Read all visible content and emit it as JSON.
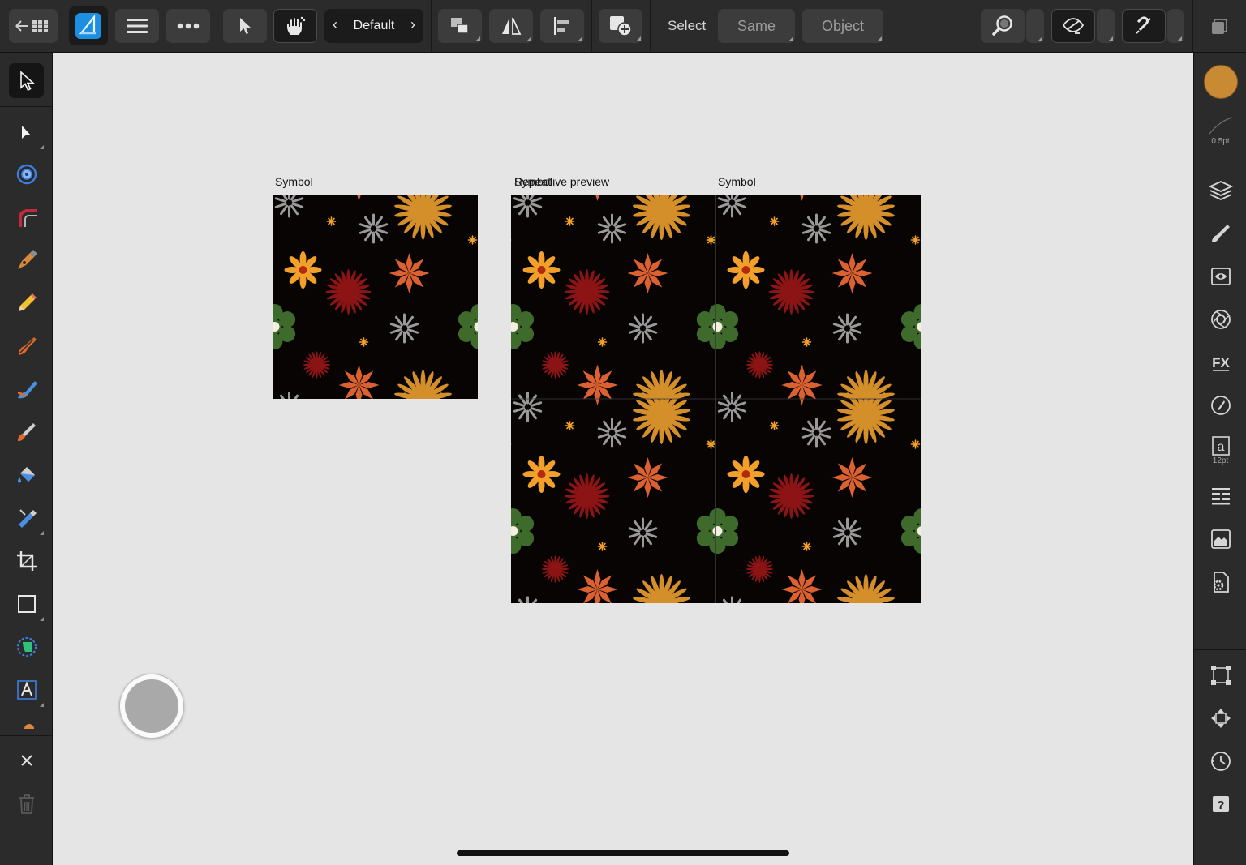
{
  "toolbar": {
    "context_label": "Default",
    "select_label": "Select",
    "same_label": "Same",
    "object_label": "Object"
  },
  "canvas": {
    "symbol_label_1": "Symbol",
    "symbol_label_2": "Symbol",
    "repeat_caption_line_a": "Repeat",
    "repeat_caption_line_b": "Symbol",
    "repeat_caption_suffix": " live preview"
  },
  "rightbar": {
    "stroke_width": "0.5pt",
    "text_size": "12pt",
    "fill_color": "#c98a34"
  },
  "pattern_colors": {
    "background": "#080404",
    "gold": "#d48f2a",
    "orange_red": "#db6130",
    "yellow": "#f2a02a",
    "dark_red": "#8c1414",
    "grey": "#9a9a9a",
    "green": "#3e6a2c"
  }
}
